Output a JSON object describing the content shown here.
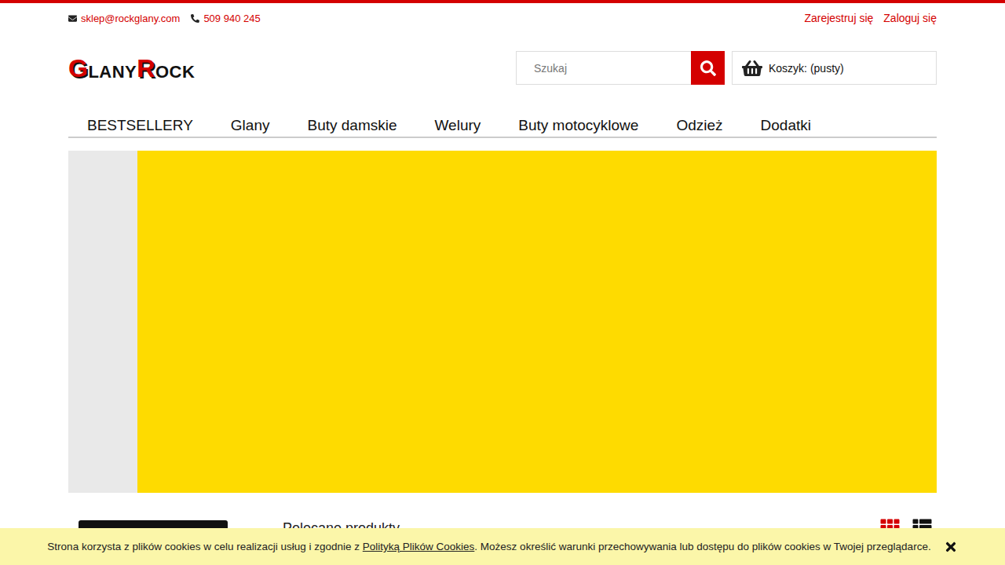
{
  "topbar": {
    "email": "sklep@rockglany.com",
    "phone": "509 940 245",
    "links": [
      "Zarejestruj się",
      "Zaloguj się"
    ]
  },
  "logo": [
    {
      "text": "G",
      "big": true,
      "color": "#d40000"
    },
    {
      "text": "LANY",
      "big": false,
      "color": "#111111"
    },
    {
      "text": "R",
      "big": true,
      "color": "#d40000"
    },
    {
      "text": "OCK",
      "big": false,
      "color": "#111111"
    }
  ],
  "search": {
    "placeholder": "Szukaj"
  },
  "cart": {
    "label": "Koszyk: (pusty)"
  },
  "nav": [
    "BESTSELLERY",
    "Glany",
    "Buty damskie",
    "Welury",
    "Buty motocyklowe",
    "Odzież",
    "Dodatki"
  ],
  "section": {
    "title": "Polecane produkty"
  },
  "views": [
    {
      "name": "grid",
      "selected": true
    },
    {
      "name": "list",
      "selected": false
    }
  ],
  "cookie": {
    "before": "Strona korzysta z plików cookies w celu realizacji usług i zgodnie z ",
    "link": "Polityką Plików Cookies",
    "after": ". Możesz określić warunki przechowywania lub dostępu do plików cookies w Twojej przeglądarce."
  }
}
